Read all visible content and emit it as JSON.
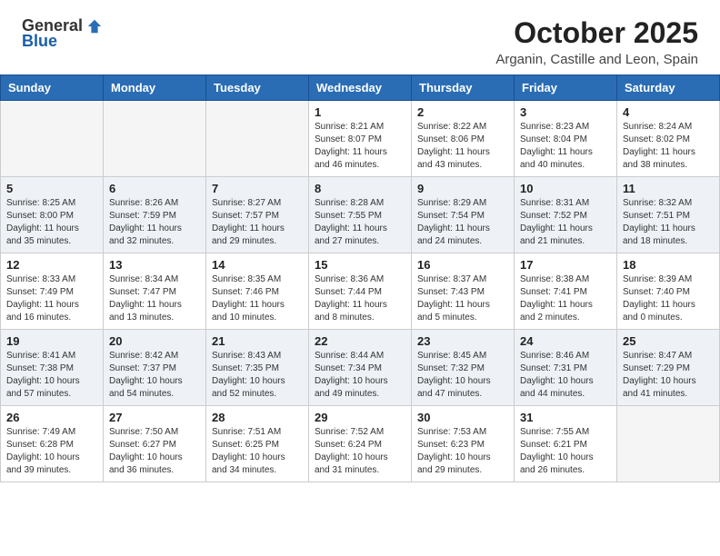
{
  "header": {
    "logo_general": "General",
    "logo_blue": "Blue",
    "month_year": "October 2025",
    "location": "Arganin, Castille and Leon, Spain"
  },
  "weekdays": [
    "Sunday",
    "Monday",
    "Tuesday",
    "Wednesday",
    "Thursday",
    "Friday",
    "Saturday"
  ],
  "weeks": [
    [
      {
        "day": "",
        "info": ""
      },
      {
        "day": "",
        "info": ""
      },
      {
        "day": "",
        "info": ""
      },
      {
        "day": "1",
        "info": "Sunrise: 8:21 AM\nSunset: 8:07 PM\nDaylight: 11 hours\nand 46 minutes."
      },
      {
        "day": "2",
        "info": "Sunrise: 8:22 AM\nSunset: 8:06 PM\nDaylight: 11 hours\nand 43 minutes."
      },
      {
        "day": "3",
        "info": "Sunrise: 8:23 AM\nSunset: 8:04 PM\nDaylight: 11 hours\nand 40 minutes."
      },
      {
        "day": "4",
        "info": "Sunrise: 8:24 AM\nSunset: 8:02 PM\nDaylight: 11 hours\nand 38 minutes."
      }
    ],
    [
      {
        "day": "5",
        "info": "Sunrise: 8:25 AM\nSunset: 8:00 PM\nDaylight: 11 hours\nand 35 minutes."
      },
      {
        "day": "6",
        "info": "Sunrise: 8:26 AM\nSunset: 7:59 PM\nDaylight: 11 hours\nand 32 minutes."
      },
      {
        "day": "7",
        "info": "Sunrise: 8:27 AM\nSunset: 7:57 PM\nDaylight: 11 hours\nand 29 minutes."
      },
      {
        "day": "8",
        "info": "Sunrise: 8:28 AM\nSunset: 7:55 PM\nDaylight: 11 hours\nand 27 minutes."
      },
      {
        "day": "9",
        "info": "Sunrise: 8:29 AM\nSunset: 7:54 PM\nDaylight: 11 hours\nand 24 minutes."
      },
      {
        "day": "10",
        "info": "Sunrise: 8:31 AM\nSunset: 7:52 PM\nDaylight: 11 hours\nand 21 minutes."
      },
      {
        "day": "11",
        "info": "Sunrise: 8:32 AM\nSunset: 7:51 PM\nDaylight: 11 hours\nand 18 minutes."
      }
    ],
    [
      {
        "day": "12",
        "info": "Sunrise: 8:33 AM\nSunset: 7:49 PM\nDaylight: 11 hours\nand 16 minutes."
      },
      {
        "day": "13",
        "info": "Sunrise: 8:34 AM\nSunset: 7:47 PM\nDaylight: 11 hours\nand 13 minutes."
      },
      {
        "day": "14",
        "info": "Sunrise: 8:35 AM\nSunset: 7:46 PM\nDaylight: 11 hours\nand 10 minutes."
      },
      {
        "day": "15",
        "info": "Sunrise: 8:36 AM\nSunset: 7:44 PM\nDaylight: 11 hours\nand 8 minutes."
      },
      {
        "day": "16",
        "info": "Sunrise: 8:37 AM\nSunset: 7:43 PM\nDaylight: 11 hours\nand 5 minutes."
      },
      {
        "day": "17",
        "info": "Sunrise: 8:38 AM\nSunset: 7:41 PM\nDaylight: 11 hours\nand 2 minutes."
      },
      {
        "day": "18",
        "info": "Sunrise: 8:39 AM\nSunset: 7:40 PM\nDaylight: 11 hours\nand 0 minutes."
      }
    ],
    [
      {
        "day": "19",
        "info": "Sunrise: 8:41 AM\nSunset: 7:38 PM\nDaylight: 10 hours\nand 57 minutes."
      },
      {
        "day": "20",
        "info": "Sunrise: 8:42 AM\nSunset: 7:37 PM\nDaylight: 10 hours\nand 54 minutes."
      },
      {
        "day": "21",
        "info": "Sunrise: 8:43 AM\nSunset: 7:35 PM\nDaylight: 10 hours\nand 52 minutes."
      },
      {
        "day": "22",
        "info": "Sunrise: 8:44 AM\nSunset: 7:34 PM\nDaylight: 10 hours\nand 49 minutes."
      },
      {
        "day": "23",
        "info": "Sunrise: 8:45 AM\nSunset: 7:32 PM\nDaylight: 10 hours\nand 47 minutes."
      },
      {
        "day": "24",
        "info": "Sunrise: 8:46 AM\nSunset: 7:31 PM\nDaylight: 10 hours\nand 44 minutes."
      },
      {
        "day": "25",
        "info": "Sunrise: 8:47 AM\nSunset: 7:29 PM\nDaylight: 10 hours\nand 41 minutes."
      }
    ],
    [
      {
        "day": "26",
        "info": "Sunrise: 7:49 AM\nSunset: 6:28 PM\nDaylight: 10 hours\nand 39 minutes."
      },
      {
        "day": "27",
        "info": "Sunrise: 7:50 AM\nSunset: 6:27 PM\nDaylight: 10 hours\nand 36 minutes."
      },
      {
        "day": "28",
        "info": "Sunrise: 7:51 AM\nSunset: 6:25 PM\nDaylight: 10 hours\nand 34 minutes."
      },
      {
        "day": "29",
        "info": "Sunrise: 7:52 AM\nSunset: 6:24 PM\nDaylight: 10 hours\nand 31 minutes."
      },
      {
        "day": "30",
        "info": "Sunrise: 7:53 AM\nSunset: 6:23 PM\nDaylight: 10 hours\nand 29 minutes."
      },
      {
        "day": "31",
        "info": "Sunrise: 7:55 AM\nSunset: 6:21 PM\nDaylight: 10 hours\nand 26 minutes."
      },
      {
        "day": "",
        "info": ""
      }
    ]
  ]
}
